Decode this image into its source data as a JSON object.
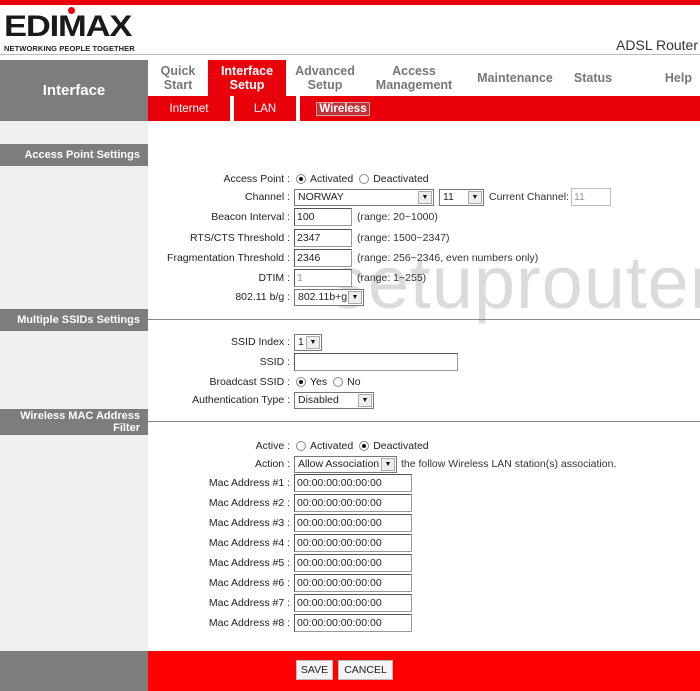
{
  "header": {
    "logo_text": "EDIMAX",
    "logo_tagline": "NETWORKING PEOPLE TOGETHER",
    "product_name": "ADSL Router",
    "brand_color": "#e8000b"
  },
  "nav": {
    "section_title": "Interface",
    "tabs": [
      {
        "label": "Quick Start",
        "active": false
      },
      {
        "label": "Interface Setup",
        "active": true
      },
      {
        "label": "Advanced Setup",
        "active": false
      },
      {
        "label": "Access Management",
        "active": false
      },
      {
        "label": "Maintenance",
        "active": false
      },
      {
        "label": "Status",
        "active": false
      },
      {
        "label": "Help",
        "active": false
      }
    ],
    "subtabs": [
      {
        "label": "Internet",
        "active": false
      },
      {
        "label": "LAN",
        "active": false
      },
      {
        "label": "Wireless",
        "active": true
      }
    ]
  },
  "watermark": "setuprouter",
  "access_point": {
    "section_title": "Access Point Settings",
    "access_point_label": "Access Point :",
    "access_point_options": [
      "Activated",
      "Deactivated"
    ],
    "access_point_selected": "Activated",
    "channel_label": "Channel :",
    "channel_country": "NORWAY",
    "channel_number": "11",
    "current_channel_label": "Current Channel:",
    "current_channel_value": "11",
    "beacon_label": "Beacon Interval :",
    "beacon_value": "100",
    "beacon_hint": "(range: 20~1000)",
    "rts_label": "RTS/CTS Threshold :",
    "rts_value": "2347",
    "rts_hint": "(range: 1500~2347)",
    "frag_label": "Fragmentation Threshold :",
    "frag_value": "2346",
    "frag_hint": "(range: 256~2346, even numbers only)",
    "dtim_label": "DTIM :",
    "dtim_value": "1",
    "dtim_hint": "(range: 1~255)",
    "mode_label": "802.11 b/g :",
    "mode_value": "802.11b+g"
  },
  "ssid": {
    "section_title": "Multiple SSIDs Settings",
    "index_label": "SSID Index :",
    "index_value": "1",
    "ssid_label": "SSID :",
    "ssid_value": "",
    "broadcast_label": "Broadcast SSID :",
    "broadcast_options": [
      "Yes",
      "No"
    ],
    "broadcast_selected": "Yes",
    "auth_label": "Authentication Type :",
    "auth_value": "Disabled"
  },
  "mac_filter": {
    "section_title_line1": "Wireless MAC Address",
    "section_title_line2": "Filter",
    "active_label": "Active :",
    "active_options": [
      "Activated",
      "Deactivated"
    ],
    "active_selected": "Deactivated",
    "action_label": "Action :",
    "action_value": "Allow Association",
    "action_suffix": "the follow Wireless LAN station(s) association.",
    "addresses": [
      {
        "label": "Mac Address #1 :",
        "value": "00:00:00:00:00:00"
      },
      {
        "label": "Mac Address #2 :",
        "value": "00:00:00:00:00:00"
      },
      {
        "label": "Mac Address #3 :",
        "value": "00:00:00:00:00:00"
      },
      {
        "label": "Mac Address #4 :",
        "value": "00:00:00:00:00:00"
      },
      {
        "label": "Mac Address #5 :",
        "value": "00:00:00:00:00:00"
      },
      {
        "label": "Mac Address #6 :",
        "value": "00:00:00:00:00:00"
      },
      {
        "label": "Mac Address #7 :",
        "value": "00:00:00:00:00:00"
      },
      {
        "label": "Mac Address #8 :",
        "value": "00:00:00:00:00:00"
      }
    ]
  },
  "footer": {
    "save_label": "SAVE",
    "cancel_label": "CANCEL"
  }
}
